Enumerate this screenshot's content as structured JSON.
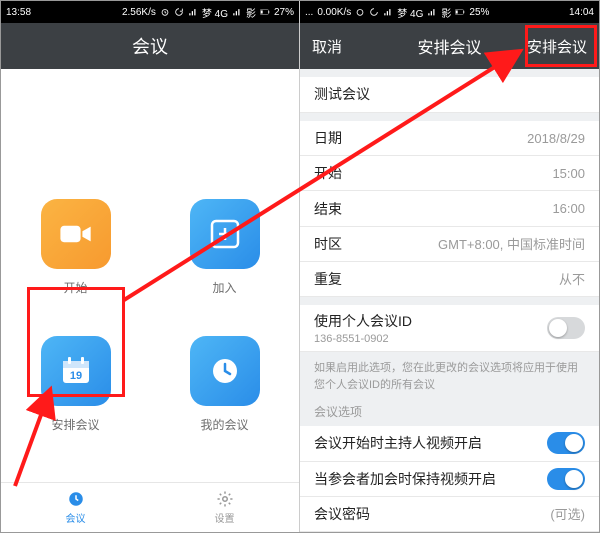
{
  "left": {
    "status": {
      "time": "13:58",
      "net": "2.56K/s",
      "carrier": "梦 4G",
      "extra": "影",
      "battery": "27%"
    },
    "nav": {
      "title": "会议"
    },
    "tiles": {
      "start": "开始",
      "join": "加入",
      "schedule": "安排会议",
      "mine": "我的会议"
    },
    "tabs": {
      "meeting": "会议",
      "settings": "设置"
    }
  },
  "right": {
    "status": {
      "time": "14:04",
      "net": "0.00K/s",
      "carrier": "梦 4G",
      "extra": "影",
      "battery": "25%"
    },
    "nav": {
      "cancel": "取消",
      "title": "安排会议",
      "done": "安排会议"
    },
    "form": {
      "name_value": "测试会议",
      "date_label": "日期",
      "date_value": "2018/8/29",
      "start_label": "开始",
      "start_value": "15:00",
      "end_label": "结束",
      "end_value": "16:00",
      "tz_label": "时区",
      "tz_value": "GMT+8:00, 中国标准时间",
      "repeat_label": "重复",
      "repeat_value": "从不",
      "pmi_label": "使用个人会议ID",
      "pmi_id": "136-8551-0902",
      "note": "如果启用此选项，您在此更改的会议选项将应用于使用您个人会议ID的所有会议",
      "options_header": "会议选项",
      "opt_host_video": "会议开始时主持人视频开启",
      "opt_attendee_video": "当参会者加会时保持视频开启",
      "opt_pwd_label": "会议密码",
      "opt_pwd_value": "(可选)"
    }
  }
}
